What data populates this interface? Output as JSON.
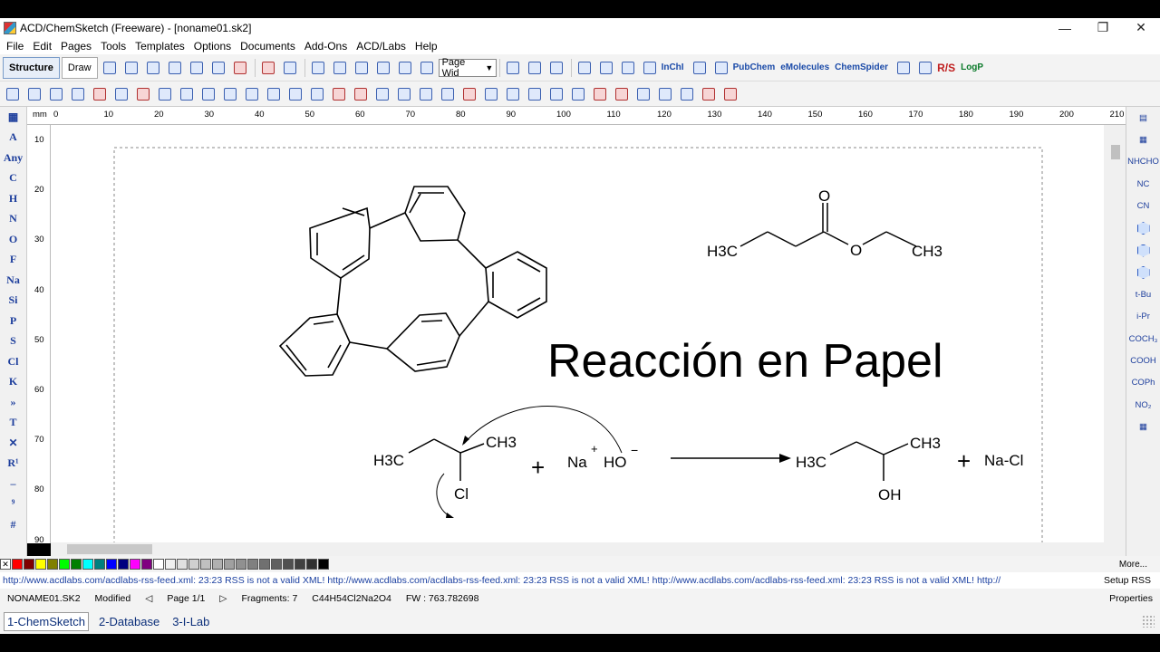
{
  "window": {
    "title": "ACD/ChemSketch (Freeware) - [noname01.sk2]",
    "controls": [
      "—",
      "❐",
      "✕"
    ]
  },
  "menu": [
    "File",
    "Edit",
    "Pages",
    "Tools",
    "Templates",
    "Options",
    "Documents",
    "Add-Ons",
    "ACD/Labs",
    "Help"
  ],
  "toolbar": {
    "structure_label": "Structure",
    "draw_label": "Draw",
    "zoom_value": "Page Wid",
    "links": [
      "InChI",
      "PubChem",
      "eMolecules",
      "ChemSpider",
      "R/S",
      "LogP"
    ]
  },
  "left_tools": [
    "A",
    "Any",
    "C",
    "H",
    "N",
    "O",
    "F",
    "Na",
    "Si",
    "P",
    "S",
    "Cl",
    "K",
    "T",
    "R¹",
    "#"
  ],
  "right_tools": [
    "NHCHO",
    "NC",
    "CN",
    "t-Bu",
    "i-Pr",
    "COCH₃",
    "COOH",
    "COPh",
    "NO₂"
  ],
  "ruler": {
    "unit": "mm",
    "top_ticks": [
      "0",
      "10",
      "20",
      "30",
      "40",
      "50",
      "60",
      "70",
      "80",
      "90",
      "100",
      "110",
      "120",
      "130",
      "140",
      "150",
      "160",
      "170",
      "180",
      "190",
      "200",
      "210"
    ],
    "left_ticks": [
      "10",
      "20",
      "30",
      "40",
      "50",
      "60",
      "70",
      "80",
      "90"
    ]
  },
  "canvas": {
    "heading": "Reacción en Papel",
    "ester": {
      "left": "H3C",
      "carbonyl_o": "O",
      "ether_o": "O",
      "right": "CH3"
    },
    "reactant": {
      "left": "H3C",
      "right": "CH3",
      "substituent": "Cl"
    },
    "plus1": "+",
    "reagent": {
      "cation": "Na",
      "cation_charge": "+",
      "anion": "HO",
      "anion_charge": "−"
    },
    "product": {
      "left": "H3C",
      "right": "CH3",
      "substituent": "OH"
    },
    "plus2": "+",
    "byproduct": "Na-Cl"
  },
  "palette": {
    "colors": [
      "#ff0000",
      "#800000",
      "#ffff00",
      "#808000",
      "#00ff00",
      "#008000",
      "#00ffff",
      "#008080",
      "#0000ff",
      "#000080",
      "#ff00ff",
      "#800080",
      "#ffffff",
      "#f0f0f0",
      "#e0e0e0",
      "#d0d0d0",
      "#c0c0c0",
      "#b0b0b0",
      "#a0a0a0",
      "#909090",
      "#808080",
      "#707070",
      "#606060",
      "#505050",
      "#404040",
      "#303030",
      "#000000"
    ],
    "more_label": "More..."
  },
  "rss": {
    "text": "http://www.acdlabs.com/acdlabs-rss-feed.xml: 23:23 RSS is not a valid XML!  http://www.acdlabs.com/acdlabs-rss-feed.xml: 23:23 RSS is not a valid XML!  http://www.acdlabs.com/acdlabs-rss-feed.xml: 23:23 RSS is not a valid XML!  http://",
    "setup_label": "Setup RSS"
  },
  "status": {
    "filename": "NONAME01.SK2",
    "state": "Modified",
    "page": "Page 1/1",
    "fragments": "Fragments: 7",
    "formula": "C44H54Cl2Na2O4",
    "fw": "FW : 763.782698",
    "properties_label": "Properties"
  },
  "page_tabs": [
    "1-ChemSketch",
    "2-Database",
    "3-I-Lab"
  ],
  "colors": {
    "toolbar_bg": "#f3f3f3",
    "icon_blue": "#1d3e9c",
    "link_blue": "#1a3fa0"
  }
}
